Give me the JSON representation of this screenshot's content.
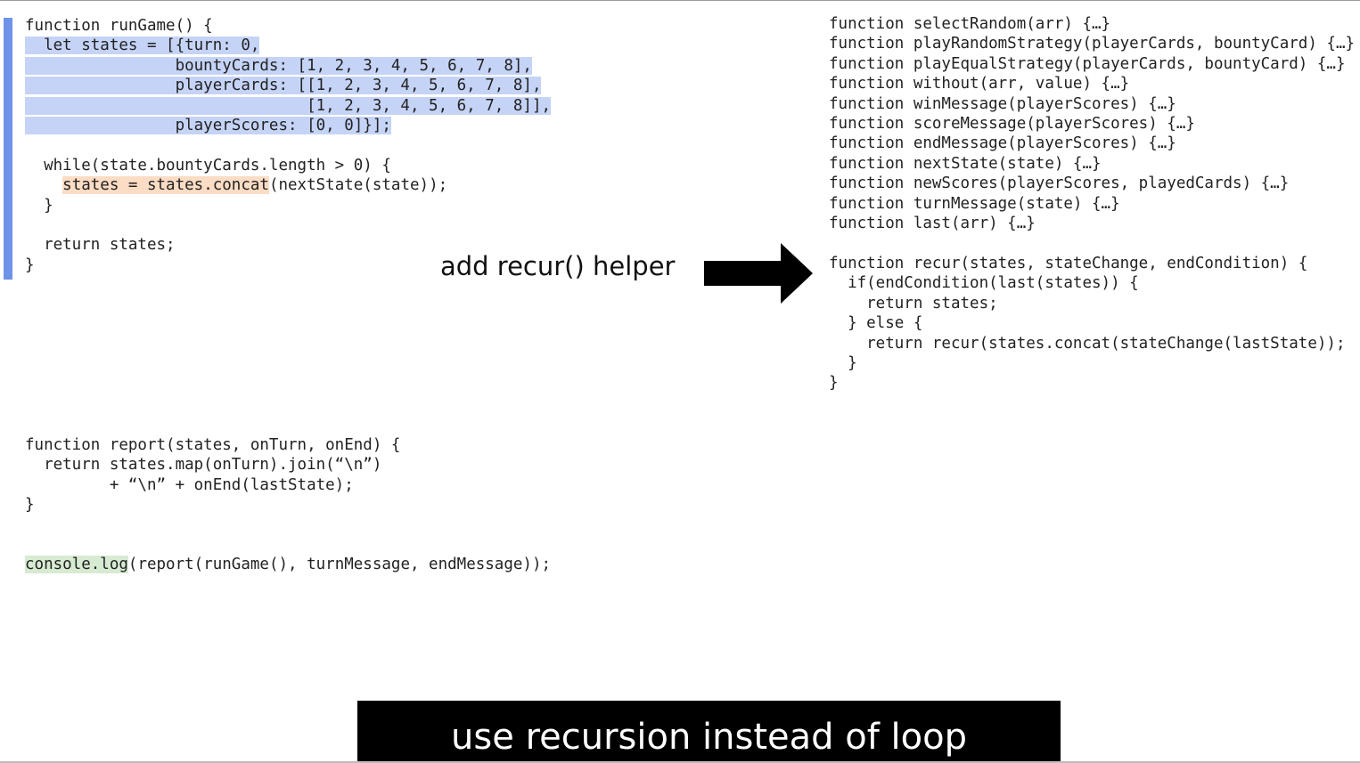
{
  "run_game": {
    "line_1": "function runGame() {",
    "line_2_hl": "  let states = [{turn: 0,",
    "line_3_hl": "                bountyCards: [1, 2, 3, 4, 5, 6, 7, 8],",
    "line_4_hl": "                playerCards: [[1, 2, 3, 4, 5, 6, 7, 8],",
    "line_5_hl": "                              [1, 2, 3, 4, 5, 6, 7, 8]],",
    "line_6_hl": "                playerScores: [0, 0]}];",
    "line_7": "",
    "line_8": "  while(state.bountyCards.length > 0) {",
    "line_9_indent": "    ",
    "line_9_hl": "states = states.concat",
    "line_9_rest": "(nextState(state));",
    "line_10": "  }",
    "line_11": "",
    "line_12": "  return states;",
    "line_13": "}"
  },
  "helpers": [
    "function selectRandom(arr) {…}",
    "function playRandomStrategy(playerCards, bountyCard) {…}",
    "function playEqualStrategy(playerCards, bountyCard) {…}",
    "function without(arr, value) {…}",
    "function winMessage(playerScores) {…}",
    "function scoreMessage(playerScores) {…}",
    "function endMessage(playerScores) {…}",
    "function nextState(state) {…}",
    "function newScores(playerScores, playedCards) {…}",
    "function turnMessage(state) {…}",
    "function last(arr) {…}"
  ],
  "recur": [
    "function recur(states, stateChange, endCondition) {",
    "  if(endCondition(last(states)) {",
    "    return states;",
    "  } else {",
    "    return recur(states.concat(stateChange(lastState));",
    "  }",
    "}"
  ],
  "report": [
    "function report(states, onTurn, onEnd) {",
    "  return states.map(onTurn).join(“\\n”)",
    "         + “\\n” + onEnd(lastState);",
    "}"
  ],
  "console_line": {
    "hl": "console.log",
    "rest": "(report(runGame(), turnMessage, endMessage));"
  },
  "annotation": "add recur() helper",
  "caption": "use recursion instead of loop",
  "colors": {
    "highlight_blue": "#c5d4f6",
    "highlight_orange": "#fbdcc4",
    "highlight_green": "#d7ebd3",
    "change_bar": "#6f93e8",
    "caption_background": "#000000",
    "caption_text": "#ffffff"
  },
  "icons": {
    "arrow": "right-arrow-icon"
  }
}
